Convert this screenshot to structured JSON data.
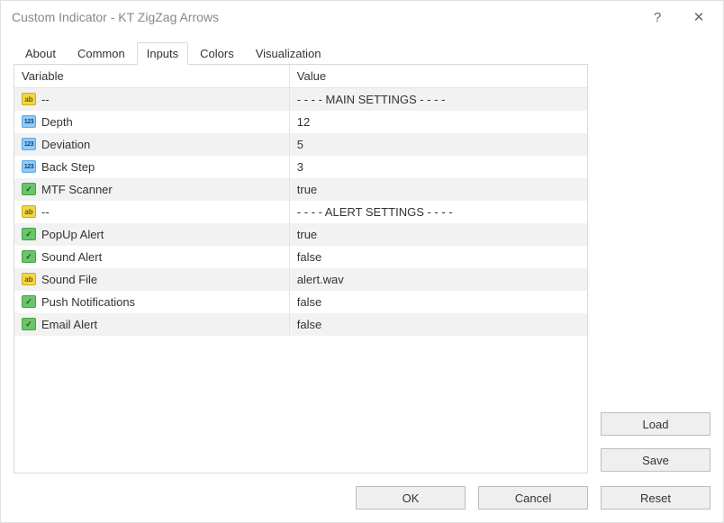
{
  "window": {
    "title": "Custom Indicator - KT ZigZag Arrows"
  },
  "titlebar_icons": {
    "help": "?",
    "close": "✕"
  },
  "tabs": {
    "items": [
      "About",
      "Common",
      "Inputs",
      "Colors",
      "Visualization"
    ],
    "active_index": 2
  },
  "table": {
    "headers": {
      "variable": "Variable",
      "value": "Value"
    },
    "rows": [
      {
        "icon": "ab",
        "name": "--",
        "value": "- - - - MAIN SETTINGS - - - -"
      },
      {
        "icon": "123",
        "name": "Depth",
        "value": "12"
      },
      {
        "icon": "123",
        "name": "Deviation",
        "value": "5"
      },
      {
        "icon": "123",
        "name": "Back Step",
        "value": "3"
      },
      {
        "icon": "bool",
        "name": "MTF Scanner",
        "value": "true"
      },
      {
        "icon": "ab",
        "name": "--",
        "value": "- - - - ALERT SETTINGS - - - -"
      },
      {
        "icon": "bool",
        "name": "PopUp Alert",
        "value": "true"
      },
      {
        "icon": "bool",
        "name": "Sound Alert",
        "value": "false"
      },
      {
        "icon": "ab",
        "name": "Sound File",
        "value": "alert.wav"
      },
      {
        "icon": "bool",
        "name": "Push Notifications",
        "value": "false"
      },
      {
        "icon": "bool",
        "name": "Email Alert",
        "value": "false"
      }
    ]
  },
  "icon_text": {
    "ab": "ab",
    "123": "123",
    "bool": "✓"
  },
  "buttons": {
    "load": "Load",
    "save": "Save",
    "ok": "OK",
    "cancel": "Cancel",
    "reset": "Reset"
  }
}
